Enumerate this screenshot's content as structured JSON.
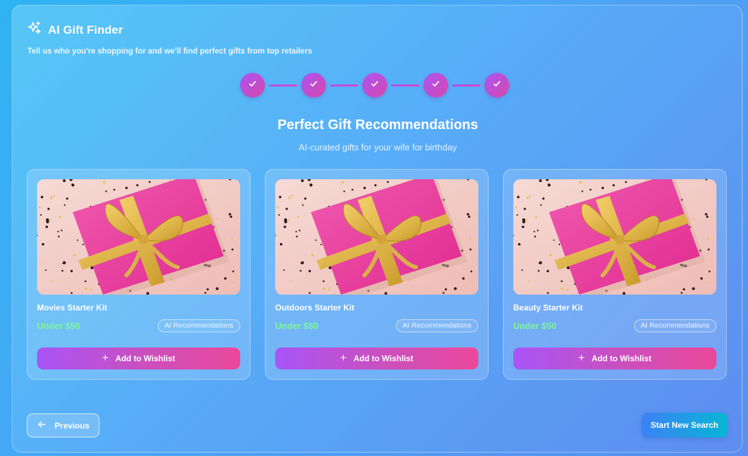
{
  "app": {
    "title": "AI Gift Finder",
    "subtitle": "Tell us who you're shopping for and we'll find perfect gifts from top retailers",
    "icon": "sparkles-icon"
  },
  "stepper": {
    "steps": [
      {
        "status": "complete",
        "icon": "check-icon"
      },
      {
        "status": "complete",
        "icon": "check-icon"
      },
      {
        "status": "complete",
        "icon": "check-icon"
      },
      {
        "status": "complete",
        "icon": "check-icon"
      },
      {
        "status": "complete",
        "icon": "check-icon"
      }
    ]
  },
  "results": {
    "title": "Perfect Gift Recommendations",
    "subtitle": "AI-curated gifts for your wife for birthday",
    "cards": [
      {
        "name": "Movies Starter Kit",
        "price": "Under $50",
        "badge": "AI Recommendations",
        "button": "Add to Wishlist",
        "image": "pink-gift-box-photo"
      },
      {
        "name": "Outdoors Starter Kit",
        "price": "Under $50",
        "badge": "AI Recommendations",
        "button": "Add to Wishlist",
        "image": "pink-gift-box-photo"
      },
      {
        "name": "Beauty Starter Kit",
        "price": "Under $50",
        "badge": "AI Recommendations",
        "button": "Add to Wishlist",
        "image": "pink-gift-box-photo"
      }
    ]
  },
  "nav": {
    "previous_label": "Previous",
    "new_search_label": "Start New Search"
  },
  "colors": {
    "accent_start": "#a855f7",
    "accent_end": "#ec4899",
    "price": "#7ef59a",
    "new_search_start": "#3b82f6",
    "new_search_end": "#06b6d4"
  }
}
